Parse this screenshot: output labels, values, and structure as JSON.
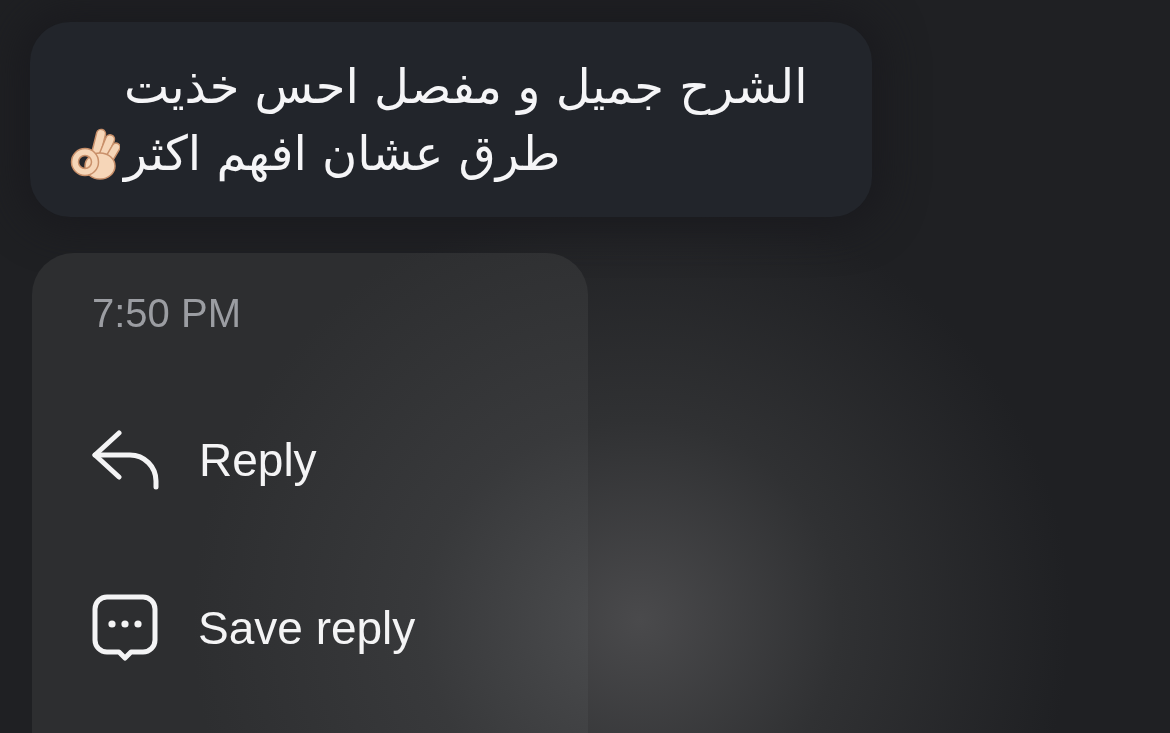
{
  "message": {
    "text": "الشرح جميل و مفصل احس خذيت طرق عشان افهم اكثر"
  },
  "menu": {
    "time": "7:50 PM",
    "items": [
      {
        "kind": "reply",
        "label": "Reply"
      },
      {
        "kind": "save",
        "label": "Save reply"
      }
    ]
  }
}
